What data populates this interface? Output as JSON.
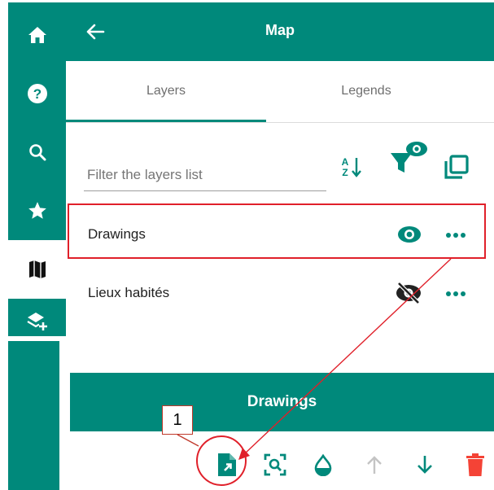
{
  "header": {
    "title": "Map"
  },
  "tabs": [
    {
      "label": "Layers",
      "active": true
    },
    {
      "label": "Legends",
      "active": false
    }
  ],
  "filter": {
    "placeholder": "Filter the layers list",
    "value": ""
  },
  "layers": [
    {
      "label": "Drawings",
      "visible": true,
      "icon_visibility": "eye-icon",
      "icon_menu": "more-icon"
    },
    {
      "label": "Lieux habités",
      "visible": false,
      "icon_visibility": "eye-off-icon",
      "icon_menu": "more-icon"
    }
  ],
  "sidebar": {
    "items": [
      {
        "icon": "home-icon"
      },
      {
        "icon": "help-icon"
      },
      {
        "icon": "search-icon"
      },
      {
        "icon": "star-icon"
      },
      {
        "icon": "map-icon",
        "active": true
      },
      {
        "icon": "add-layer-icon"
      }
    ]
  },
  "layer_tools": {
    "title": "Drawings"
  },
  "callout": {
    "number": "1"
  },
  "colors": {
    "teal": "#00897b",
    "highlight": "#e0202a",
    "delete": "#f44336"
  }
}
